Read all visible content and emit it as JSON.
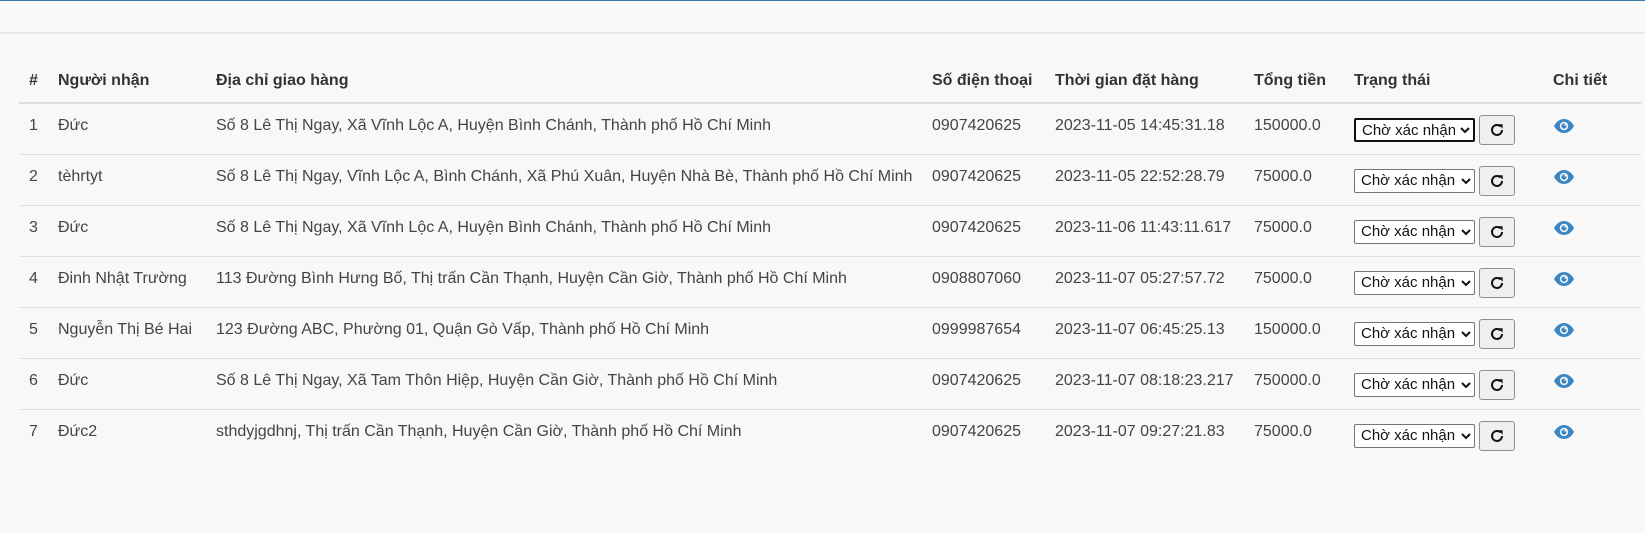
{
  "table": {
    "headers": {
      "index": "#",
      "recipient": "Người nhận",
      "address": "Địa chỉ giao hàng",
      "phone": "Số điện thoại",
      "order_time": "Thời gian đặt hàng",
      "total": "Tổng tiền",
      "status": "Trạng thái",
      "detail": "Chi tiết"
    },
    "rows": [
      {
        "index": "1",
        "recipient": "Đức",
        "address": "Số 8 Lê Thị Ngay, Xã Vĩnh Lộc A, Huyện Bình Chánh, Thành phố Hồ Chí Minh",
        "phone": "0907420625",
        "order_time": "2023-11-05 14:45:31.18",
        "total": "150000.0",
        "status": "Chờ xác nhận"
      },
      {
        "index": "2",
        "recipient": "tèhrtyt",
        "address": "Số 8 Lê Thị Ngay, Vĩnh Lộc A, Bình Chánh, Xã Phú Xuân, Huyện Nhà Bè, Thành phố Hồ Chí Minh",
        "phone": "0907420625",
        "order_time": "2023-11-05 22:52:28.79",
        "total": "75000.0",
        "status": "Chờ xác nhận"
      },
      {
        "index": "3",
        "recipient": "Đức",
        "address": "Số 8 Lê Thị Ngay, Xã Vĩnh Lộc A, Huyện Bình Chánh, Thành phố Hồ Chí Minh",
        "phone": "0907420625",
        "order_time": "2023-11-06 11:43:11.617",
        "total": "75000.0",
        "status": "Chờ xác nhận"
      },
      {
        "index": "4",
        "recipient": "Đinh Nhật Trường",
        "address": "113 Đường Bình Hưng Bố, Thị trấn Cần Thạnh, Huyện Cần Giờ, Thành phố Hồ Chí Minh",
        "phone": "0908807060",
        "order_time": "2023-11-07 05:27:57.72",
        "total": "75000.0",
        "status": "Chờ xác nhận"
      },
      {
        "index": "5",
        "recipient": "Nguyễn Thị Bé Hai",
        "address": "123 Đường ABC, Phường 01, Quận Gò Vấp, Thành phố Hồ Chí Minh",
        "phone": "0999987654",
        "order_time": "2023-11-07 06:45:25.13",
        "total": "150000.0",
        "status": "Chờ xác nhận"
      },
      {
        "index": "6",
        "recipient": "Đức",
        "address": "Số 8 Lê Thị Ngay, Xã Tam Thôn Hiệp, Huyện Cần Giờ, Thành phố Hồ Chí Minh",
        "phone": "0907420625",
        "order_time": "2023-11-07 08:18:23.217",
        "total": "750000.0",
        "status": "Chờ xác nhận"
      },
      {
        "index": "7",
        "recipient": "Đức2",
        "address": "sthdyjgdhnj, Thị trấn Cần Thạnh, Huyện Cần Giờ, Thành phố Hồ Chí Minh",
        "phone": "0907420625",
        "order_time": "2023-11-07 09:27:21.83",
        "total": "75000.0",
        "status": "Chờ xác nhận"
      }
    ]
  },
  "icons": {
    "refresh": "refresh-icon",
    "view": "eye-icon"
  },
  "colors": {
    "accent": "#3c7fb1",
    "eye": "#3a86c4"
  }
}
